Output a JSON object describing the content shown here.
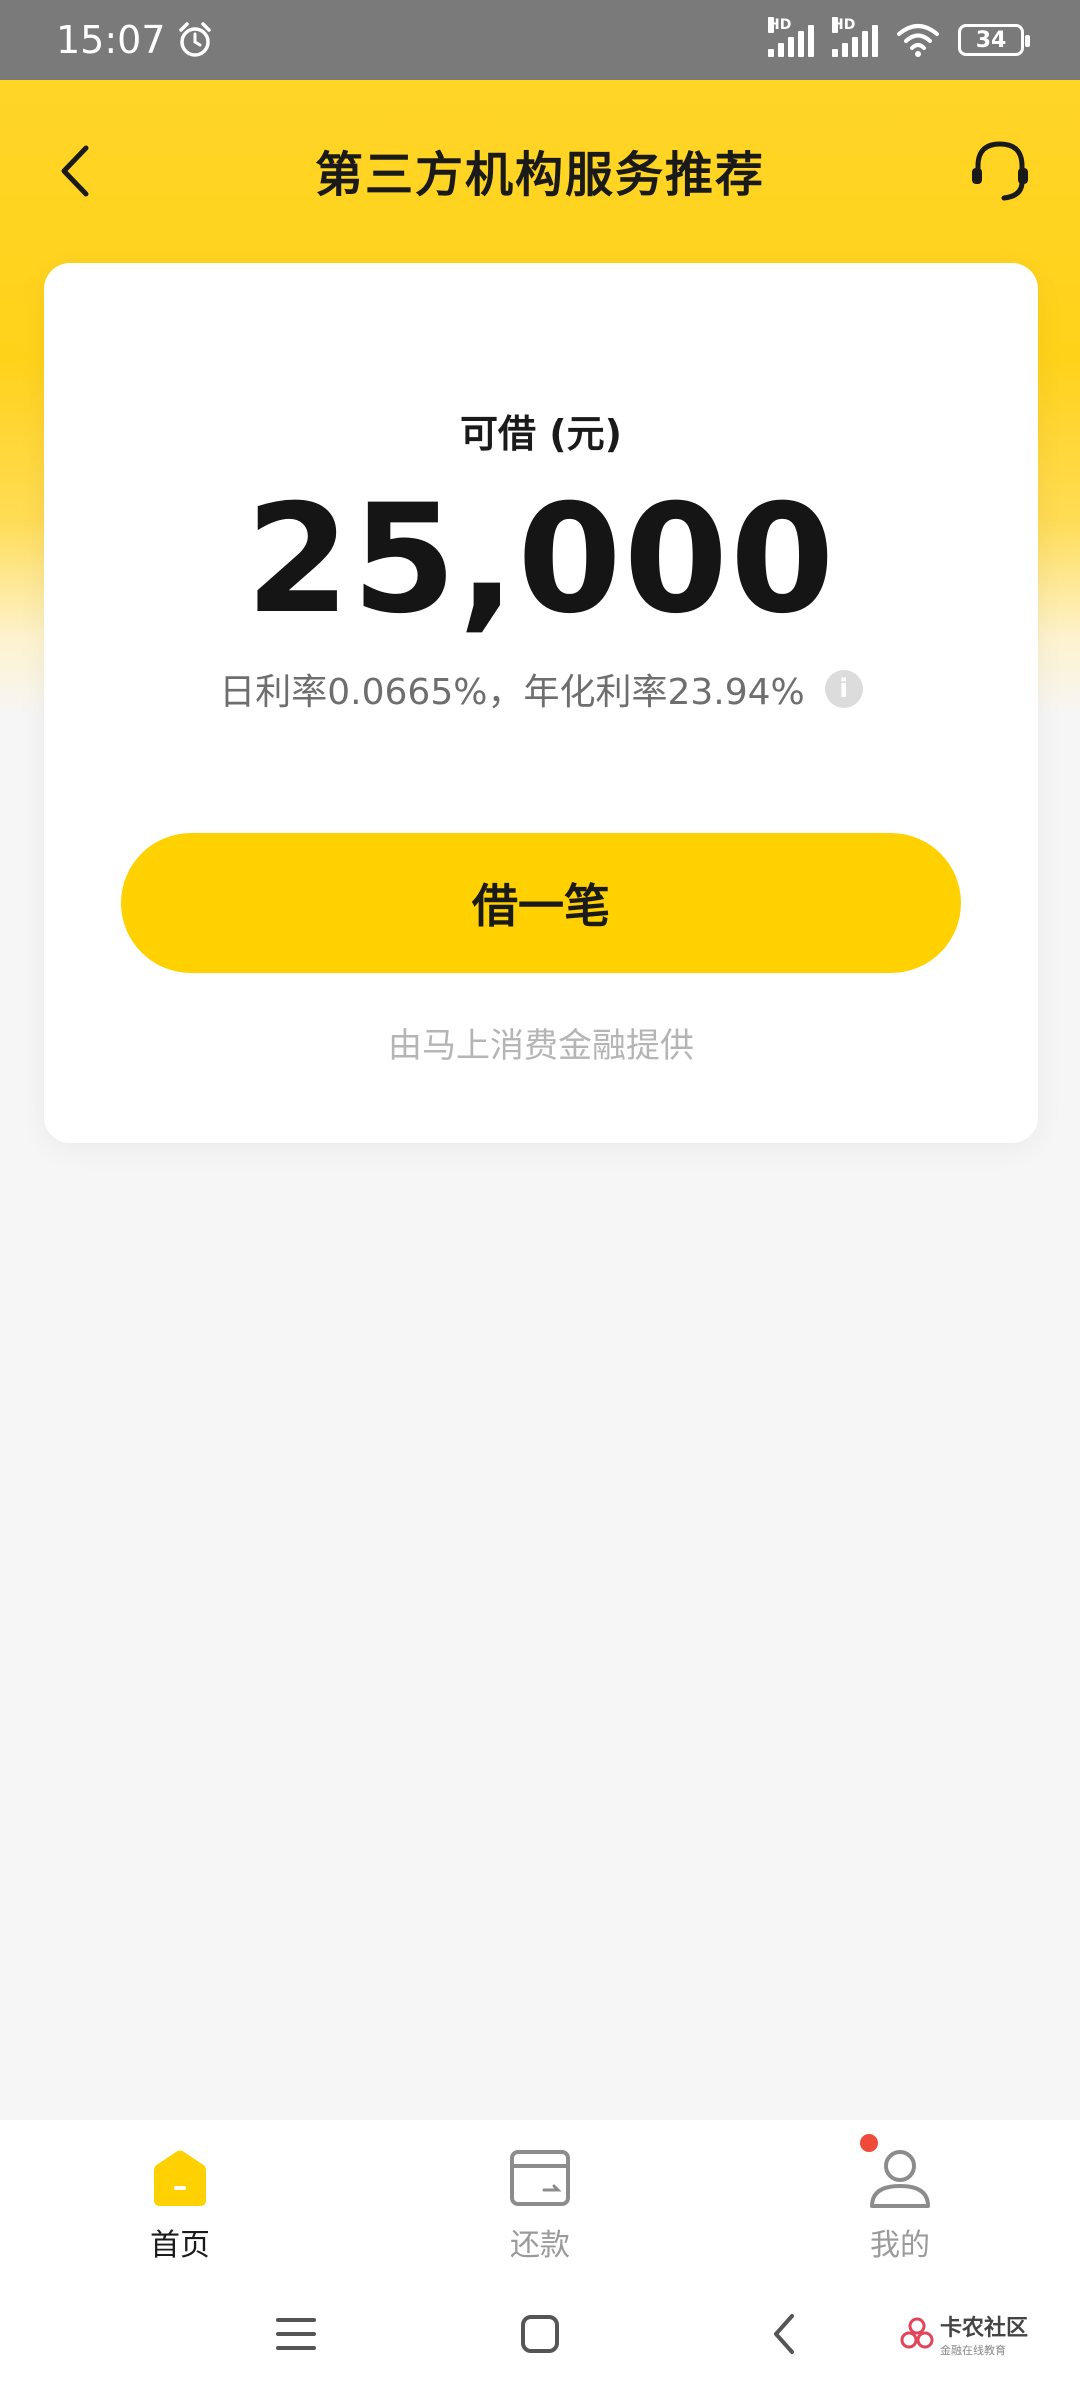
{
  "status_bar": {
    "time": "15:07",
    "battery": "34",
    "signal_1_label": "HD",
    "signal_2_label": "HD"
  },
  "nav": {
    "title": "第三方机构服务推荐"
  },
  "card": {
    "label": "可借 (元)",
    "amount": "25,000",
    "rate_text": "日利率0.0665%，年化利率23.94%",
    "info_symbol": "i",
    "button_label": "借一笔",
    "provider": "由马上消费金融提供"
  },
  "tabbar": {
    "items": [
      {
        "label": "首页",
        "icon": "home-icon",
        "active": true
      },
      {
        "label": "还款",
        "icon": "repay-icon",
        "active": false
      },
      {
        "label": "我的",
        "icon": "profile-icon",
        "active": false
      }
    ]
  },
  "watermark": {
    "main": "卡农社区",
    "sub": "金融在线教育"
  },
  "colors": {
    "accent": "#ffd100",
    "badge": "#f04b3a"
  }
}
